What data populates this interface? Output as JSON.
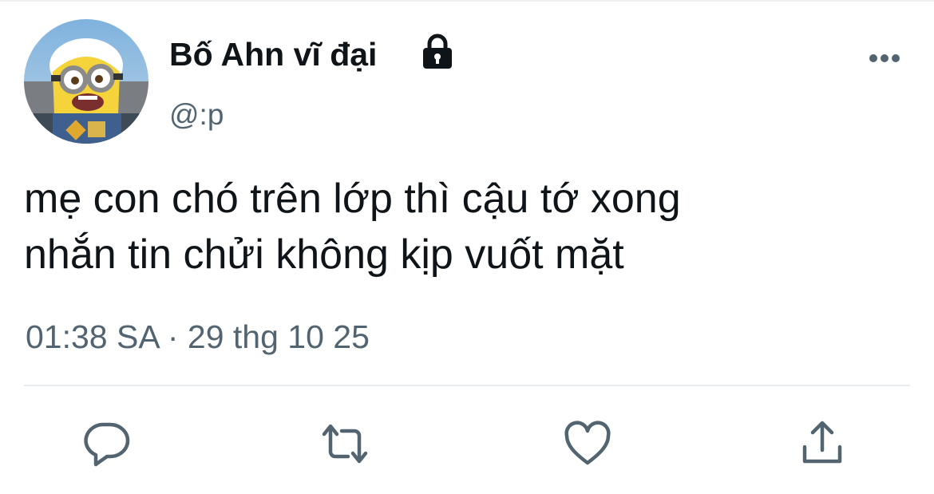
{
  "tweet": {
    "display_name": "Bố Ahn vĩ đại",
    "handle": "@:p",
    "text_lines": [
      "mẹ con chó trên lớp thì cậu tớ xong",
      "nhắn tin chửi không kịp vuốt mặt"
    ],
    "time": "01:38 SA",
    "separator": "·",
    "date": "29 thg 10 25",
    "protected_icon": "lock-icon",
    "avatar": "minion-avatar"
  },
  "actions": [
    {
      "icon": "reply-icon"
    },
    {
      "icon": "retweet-icon"
    },
    {
      "icon": "like-icon"
    },
    {
      "icon": "share-icon"
    }
  ],
  "menu": {
    "icon": "more-options-icon"
  },
  "colors": {
    "primary_text": "#0f1419",
    "secondary_text": "#536471",
    "icon": "#536471",
    "divider": "#e6ecf0"
  }
}
